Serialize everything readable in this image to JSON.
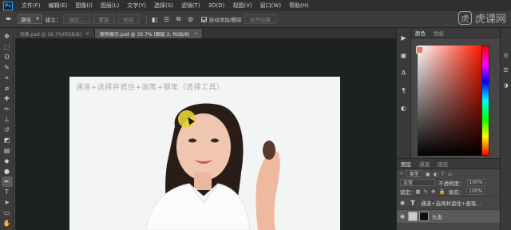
{
  "menubar": {
    "logo": "Ps",
    "items": [
      "文件(F)",
      "编辑(E)",
      "图像(I)",
      "图层(L)",
      "文字(Y)",
      "选择(S)",
      "滤镜(T)",
      "3D(D)",
      "视图(V)",
      "窗口(W)",
      "帮助(H)"
    ]
  },
  "options": {
    "path_mode": "路径",
    "make_label": "建立：",
    "selection_btn": "选区...",
    "mask_btn": "蒙版",
    "shape_btn": "形状",
    "auto_add_delete": "自动添加/删除",
    "align_edges": "对齐边缘"
  },
  "watermark": {
    "logo_char": "虎",
    "text": "虎课网"
  },
  "tabs": [
    {
      "label": "现象.psd @ 36.7%(RGB/8)",
      "active": false
    },
    {
      "label": "案例展示.psd @ 33.7% (图层 2, RGB/8)",
      "active": true
    }
  ],
  "canvas": {
    "caption": "通道+选择并遮住+画笔+钢笔（选择工具）"
  },
  "color_panel": {
    "tabs": [
      "颜色",
      "色板"
    ],
    "fg_color": "#e07a5f",
    "bg_color": "#ffffff"
  },
  "layers_panel": {
    "tabs": [
      "图层",
      "通道",
      "路径"
    ],
    "kind_label": "类型",
    "blend_mode": "正常",
    "opacity_label": "不透明度：",
    "opacity_value": "100%",
    "lock_label": "锁定：",
    "fill_label": "填充：",
    "fill_value": "100%",
    "layers": [
      {
        "name": "通道+选择并遮住+画笔...",
        "type": "text"
      },
      {
        "name": "头发",
        "type": "image"
      }
    ]
  }
}
